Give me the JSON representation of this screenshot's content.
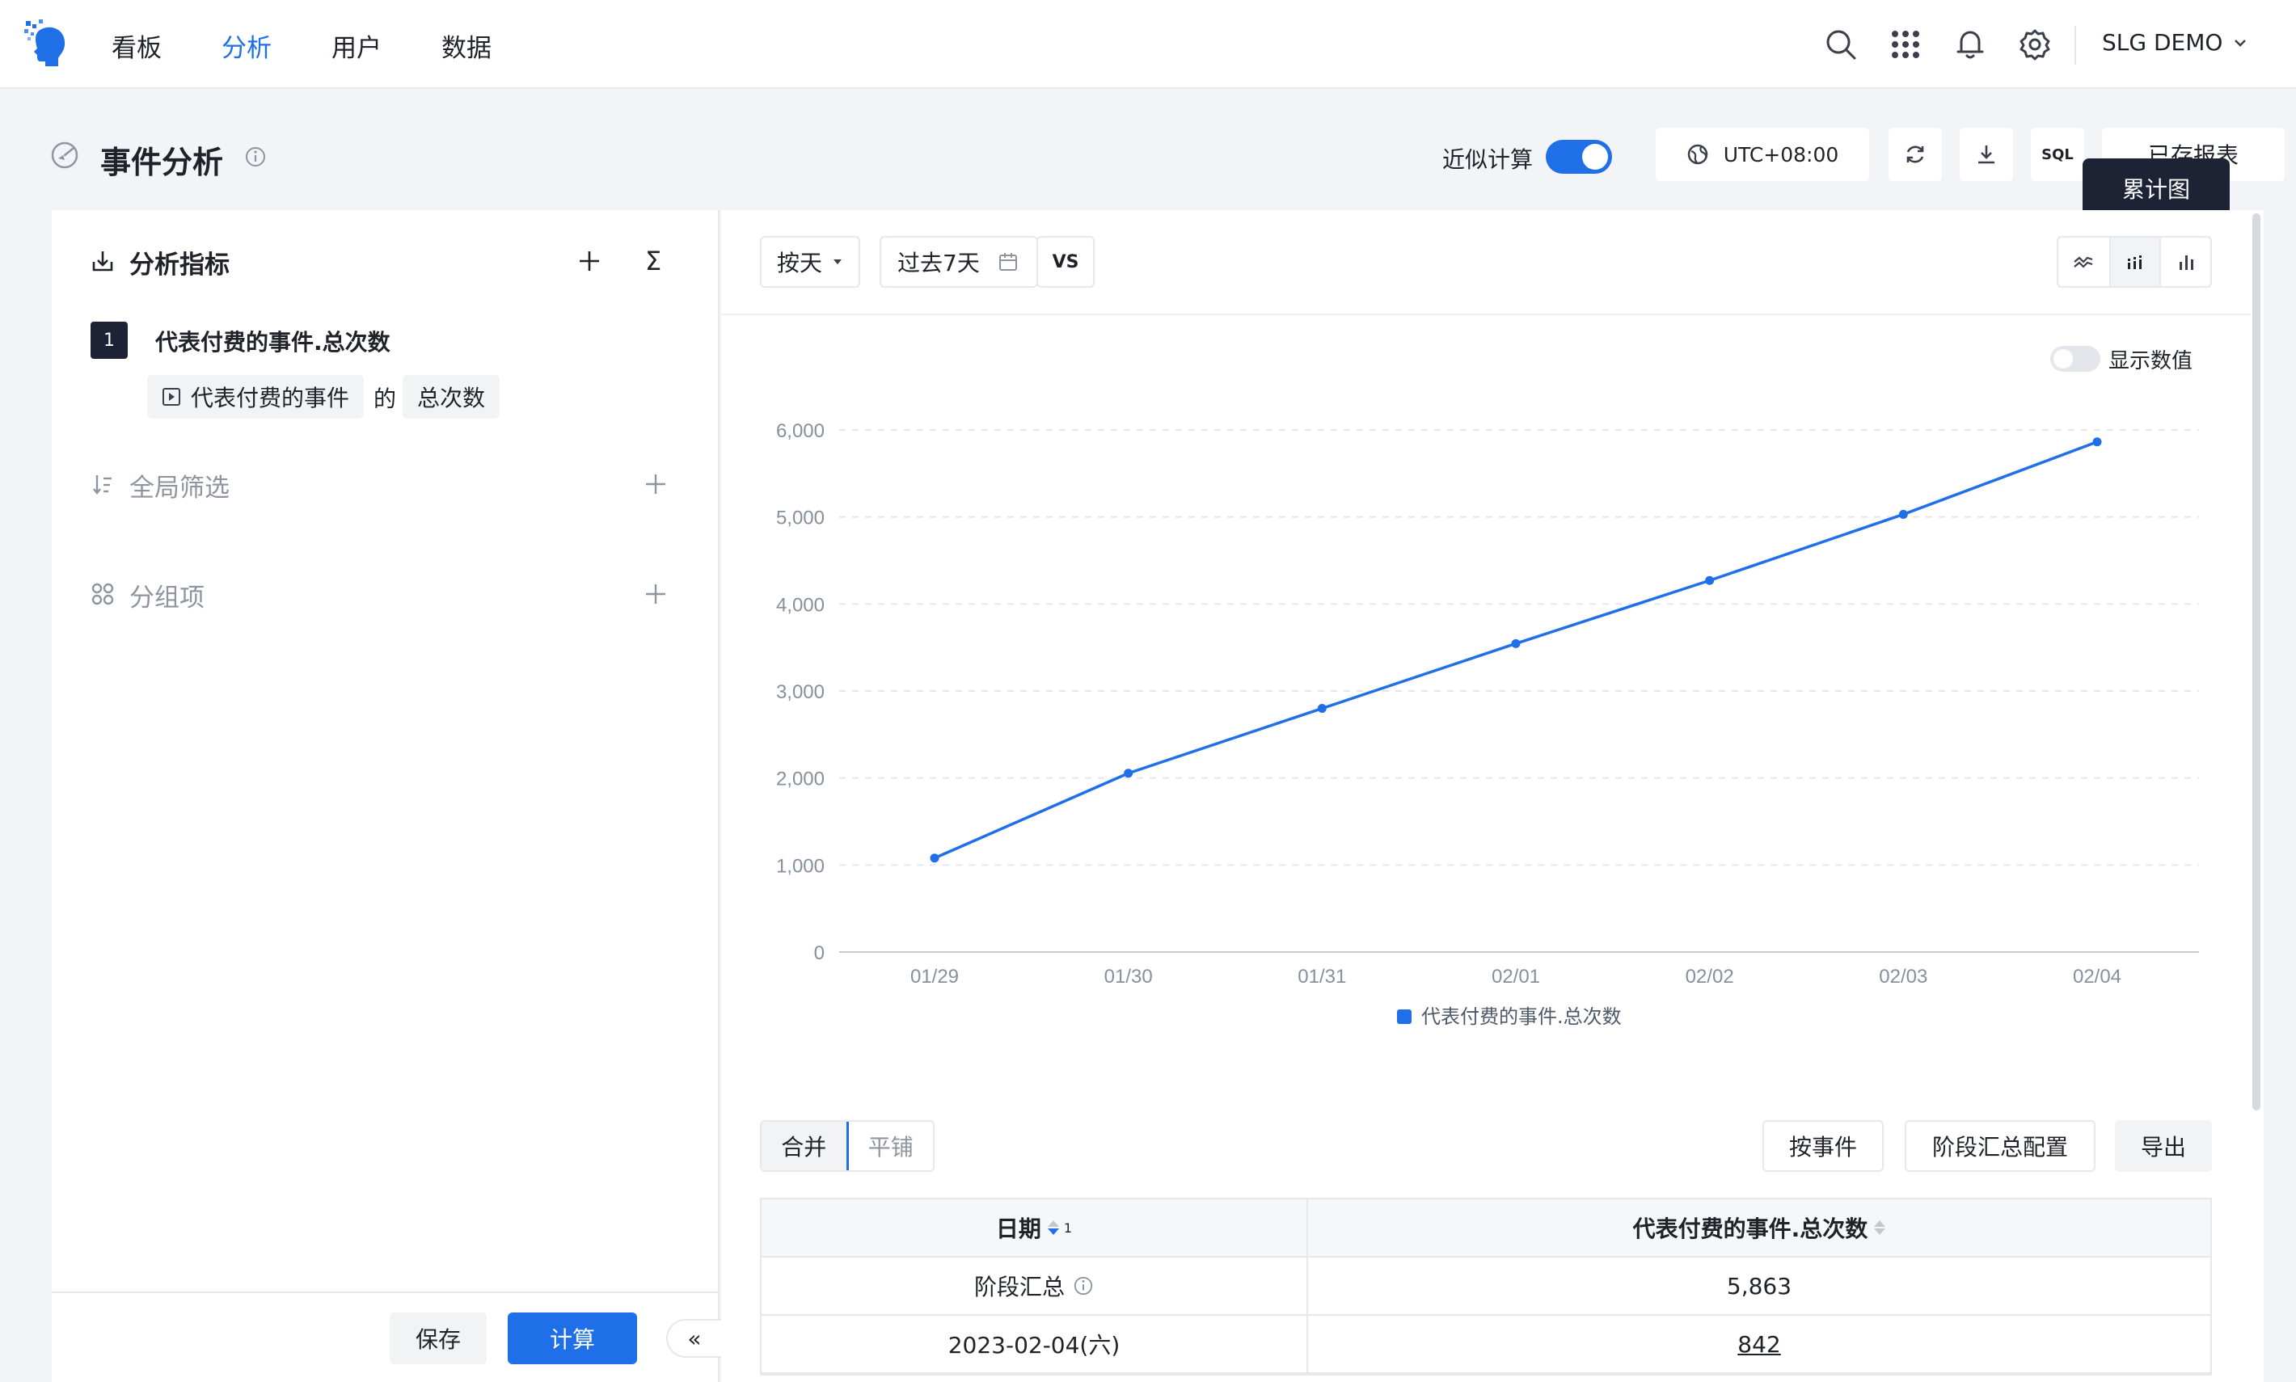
{
  "nav": {
    "items": [
      {
        "label": "看板",
        "active": false
      },
      {
        "label": "分析",
        "active": true
      },
      {
        "label": "用户",
        "active": false
      },
      {
        "label": "数据",
        "active": false
      }
    ],
    "project_name": "SLG DEMO",
    "accent_color": "#1e6fe8"
  },
  "header": {
    "title": "事件分析",
    "approx_label": "近似计算",
    "approx_enabled": true,
    "timezone": "UTC+08:00",
    "sql_label": "SQL",
    "saved_reports_label": "已存报表",
    "tooltip": "累计图"
  },
  "left": {
    "metrics_title": "分析指标",
    "metric_index": "1",
    "metric_name": "代表付费的事件.总次数",
    "event_chip": "代表付费的事件",
    "of_text": "的",
    "agg_chip": "总次数",
    "filter_title": "全局筛选",
    "group_title": "分组项",
    "save_label": "保存",
    "calc_label": "计算",
    "collapse_label": "«"
  },
  "toolbar": {
    "granularity": "按天",
    "date_range": "过去7天",
    "vs_label": "VS",
    "show_values_label": "显示数值",
    "show_values_enabled": false,
    "chart_types": [
      "trend-line",
      "cumulative",
      "bar"
    ],
    "active_chart_type": "cumulative"
  },
  "chart_data": {
    "type": "line",
    "x": [
      "01/29",
      "01/30",
      "01/31",
      "02/01",
      "02/02",
      "02/03",
      "02/04"
    ],
    "series": [
      {
        "name": "代表付费的事件.总次数",
        "values": [
          1080,
          2055,
          2800,
          3545,
          4270,
          5030,
          5863
        ],
        "color": "#1e6fe8"
      }
    ],
    "y_ticks": [
      "0",
      "1,000",
      "2,000",
      "3,000",
      "4,000",
      "5,000",
      "6,000"
    ],
    "ylim": [
      0,
      6000
    ],
    "grid": true,
    "legend_position": "bottom-center"
  },
  "table": {
    "mode_tabs": [
      {
        "label": "合并",
        "active": true
      },
      {
        "label": "平铺",
        "active": false
      }
    ],
    "by_event_label": "按事件",
    "stage_config_label": "阶段汇总配置",
    "export_label": "导出",
    "col_date": "日期",
    "col_date_sort_index": "1",
    "col_value": "代表付费的事件.总次数",
    "rows": [
      {
        "date": "阶段汇总",
        "value": "5,863",
        "summary": true
      },
      {
        "date": "2023-02-04(六)",
        "value": "842",
        "summary": false
      }
    ]
  }
}
